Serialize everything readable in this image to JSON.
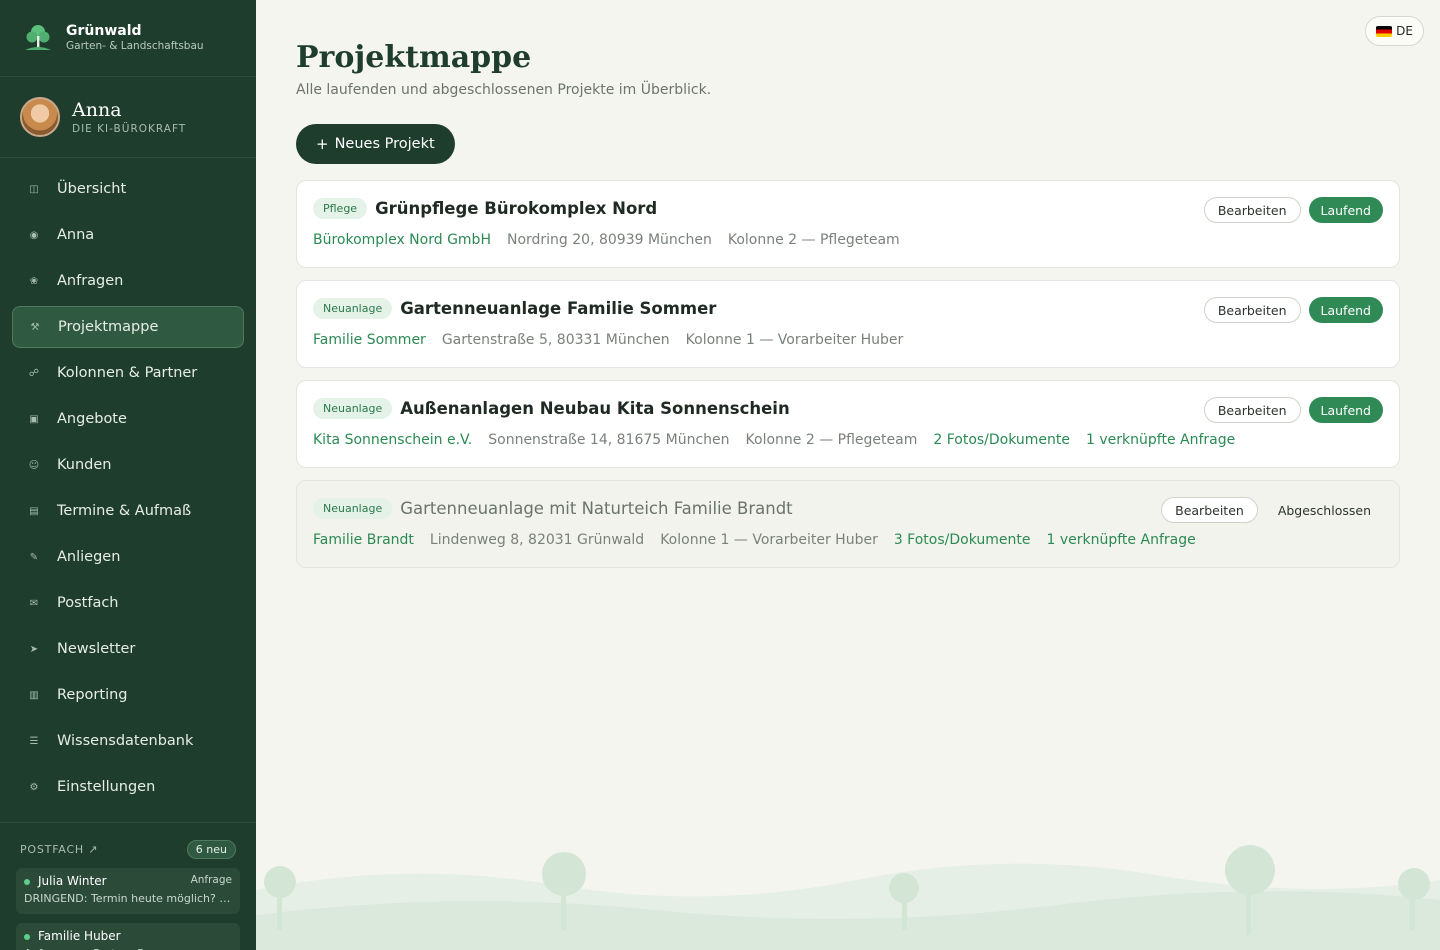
{
  "brand": {
    "name": "Grünwald",
    "subtitle": "Garten- & Landschaftsbau"
  },
  "profile": {
    "name": "Anna",
    "role": "DIE KI-BÜROKRAFT"
  },
  "nav": [
    {
      "label": "Übersicht",
      "icon": "grid-icon",
      "glyph": "◫"
    },
    {
      "label": "Anna",
      "icon": "circle-icon",
      "glyph": "◉"
    },
    {
      "label": "Anfragen",
      "icon": "flower-icon",
      "glyph": "❀"
    },
    {
      "label": "Projektmappe",
      "icon": "tools-icon",
      "glyph": "⚒",
      "active": true
    },
    {
      "label": "Kolonnen & Partner",
      "icon": "people-icon",
      "glyph": "☍"
    },
    {
      "label": "Angebote",
      "icon": "square-icon",
      "glyph": "▣"
    },
    {
      "label": "Kunden",
      "icon": "smile-icon",
      "glyph": "☺"
    },
    {
      "label": "Termine & Aufmaß",
      "icon": "calendar-icon",
      "glyph": "▤"
    },
    {
      "label": "Anliegen",
      "icon": "pen-icon",
      "glyph": "✎"
    },
    {
      "label": "Postfach",
      "icon": "mail-icon",
      "glyph": "✉"
    },
    {
      "label": "Newsletter",
      "icon": "send-icon",
      "glyph": "➤"
    },
    {
      "label": "Reporting",
      "icon": "chart-icon",
      "glyph": "▥"
    },
    {
      "label": "Wissensdatenbank",
      "icon": "list-icon",
      "glyph": "☰"
    },
    {
      "label": "Einstellungen",
      "icon": "gear-icon",
      "glyph": "⚙"
    }
  ],
  "inbox": {
    "title": "POSTFACH ↗",
    "badge": "6 neu",
    "items": [
      {
        "sender": "Julia Winter",
        "tag": "Anfrage",
        "message": "DRINGEND: Termin heute möglich? Wasserrohrbruch"
      },
      {
        "sender": "Familie Huber",
        "tag": "",
        "message": "Anfrage zur Gartenpflege"
      }
    ]
  },
  "lang": {
    "label": "DE"
  },
  "page": {
    "title": "Projektmappe",
    "subtitle": "Alle laufenden und abgeschlossenen Projekte im Überblick.",
    "new_button": "Neues Projekt"
  },
  "edit_label": "Bearbeiten",
  "projects": [
    {
      "tag": "Pflege",
      "title": "Grünpflege Bürokomplex Nord",
      "client": "Bürokomplex Nord GmbH",
      "address": "Nordring 20, 80939 München",
      "team": "Kolonne 2 — Pflegeteam",
      "docs": "",
      "linked": "",
      "status": "Laufend",
      "done": false
    },
    {
      "tag": "Neuanlage",
      "title": "Gartenneuanlage Familie Sommer",
      "client": "Familie Sommer",
      "address": "Gartenstraße 5, 80331 München",
      "team": "Kolonne 1 — Vorarbeiter Huber",
      "docs": "",
      "linked": "",
      "status": "Laufend",
      "done": false
    },
    {
      "tag": "Neuanlage",
      "title": "Außenanlagen Neubau Kita Sonnenschein",
      "client": "Kita Sonnenschein e.V.",
      "address": "Sonnenstraße 14, 81675 München",
      "team": "Kolonne 2 — Pflegeteam",
      "docs": "2 Fotos/Dokumente",
      "linked": "1 verknüpfte Anfrage",
      "status": "Laufend",
      "done": false
    },
    {
      "tag": "Neuanlage",
      "title": "Gartenneuanlage mit Naturteich Familie Brandt",
      "client": "Familie Brandt",
      "address": "Lindenweg 8, 82031 Grünwald",
      "team": "Kolonne 1 — Vorarbeiter Huber",
      "docs": "3 Fotos/Dokumente",
      "linked": "1 verknüpfte Anfrage",
      "status": "Abgeschlossen",
      "done": true
    }
  ]
}
